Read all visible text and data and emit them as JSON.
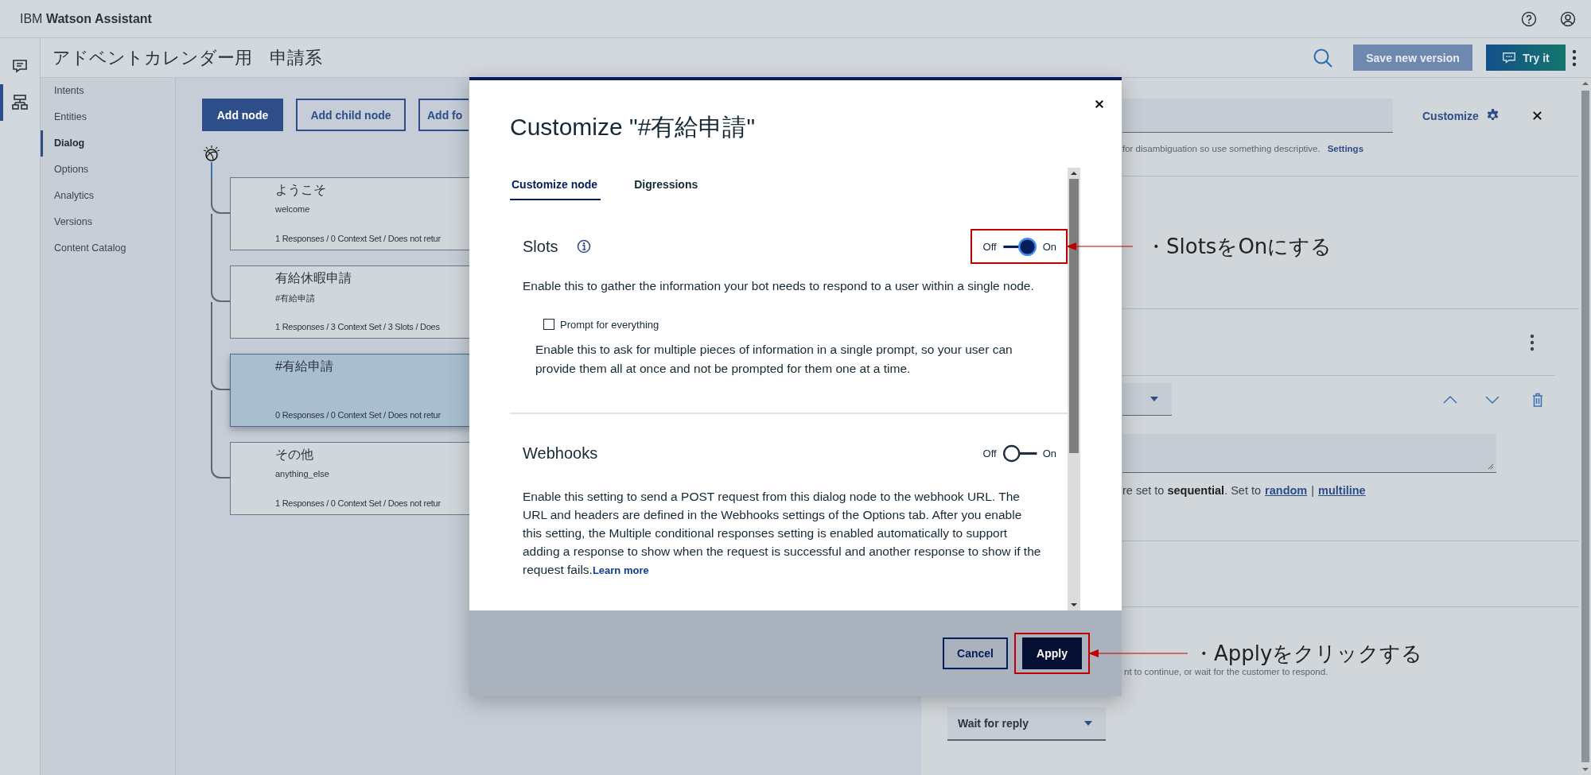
{
  "header": {
    "brand_prefix": "IBM",
    "brand_name": "Watson Assistant"
  },
  "rail": [
    {
      "kind": "chat",
      "selected": false
    },
    {
      "kind": "dialog",
      "selected": true
    }
  ],
  "workspace": {
    "title": "アドベントカレンダー用　申請系",
    "save_button": "Save new version",
    "try_button": "Try it"
  },
  "nav": [
    {
      "label": "Intents",
      "selected": false
    },
    {
      "label": "Entities",
      "selected": false
    },
    {
      "label": "Dialog",
      "selected": true
    },
    {
      "label": "Options",
      "selected": false
    },
    {
      "label": "Analytics",
      "selected": false
    },
    {
      "label": "Versions",
      "selected": false
    },
    {
      "label": "Content Catalog",
      "selected": false
    }
  ],
  "toolbar": [
    {
      "label": "Add node",
      "kind": "primary"
    },
    {
      "label": "Add child node",
      "kind": "secondary"
    },
    {
      "label": "Add fo",
      "kind": "secondary"
    }
  ],
  "nodes": [
    {
      "title": "ようこそ",
      "condition": "welcome",
      "summary": "1 Responses / 0 Context Set / Does not retur",
      "selected": false
    },
    {
      "title": "有給休暇申請",
      "condition": "#有給申請",
      "summary": "1 Responses / 3 Context Set / 3 Slots / Does",
      "selected": false
    },
    {
      "title": "#有給申請",
      "summary": "0 Responses / 0 Context Set / Does not retur",
      "selected": true
    },
    {
      "title": "その他",
      "condition": "anything_else",
      "summary": "1 Responses / 0 Context Set / Does not retur",
      "selected": false
    }
  ],
  "editor": {
    "customize_link": "Customize",
    "name_help": "for disambiguation so use something descriptive.",
    "settings_link": "Settings",
    "variation_note": "re set to **sequential**. Set to",
    "variation_links": [
      "random",
      "multiline"
    ],
    "separator": "|",
    "next_step_help": "nt to continue, or wait for the customer to respond.",
    "next_step": "Wait for reply"
  },
  "modal": {
    "title": "Customize \"#有給申請\"",
    "tabs": [
      {
        "label": "Customize node",
        "selected": true
      },
      {
        "label": "Digressions",
        "selected": false
      }
    ],
    "sections": [
      {
        "title": "Slots",
        "info": true,
        "off_label": "Off",
        "on_label": "On",
        "on": true,
        "note": "・SlotsをOnにする",
        "description": "Enable this to gather the information your bot needs to respond to a user within a single node.",
        "option": {
          "label": "Prompt for everything",
          "checked": false,
          "description": "Enable this to ask for multiple pieces of information in a single prompt, so your user can provide them all at once and not be prompted for them one at a time."
        }
      },
      {
        "title": "Webhooks",
        "info": false,
        "off_label": "Off",
        "on_label": "On",
        "on": false,
        "description": "Enable this setting to send a POST request from this dialog node to the webhook URL. The URL and headers are defined in the Webhooks settings of the Options tab. After you enable this setting, the Multiple conditional responses setting is enabled automatically to support adding a response to show when the request is successful and another response to show if the request fails.",
        "link": "Learn more"
      }
    ],
    "cancel": "Cancel",
    "apply": "Apply",
    "apply_note": "・Applyをクリックする"
  }
}
